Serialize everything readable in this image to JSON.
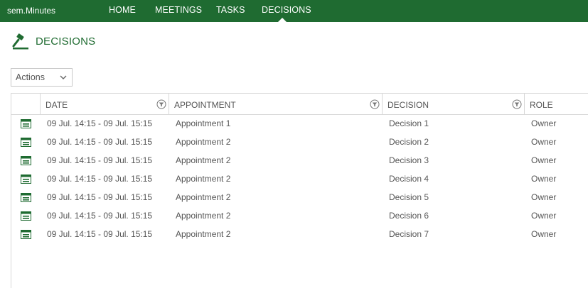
{
  "app": {
    "brand": "sem.Minutes"
  },
  "nav": {
    "items": [
      {
        "label": "HOME"
      },
      {
        "label": "MEETINGS"
      },
      {
        "label": "TASKS"
      },
      {
        "label": "DECISIONS",
        "active": true
      }
    ]
  },
  "page": {
    "title": "DECISIONS",
    "icon": "gavel-icon"
  },
  "toolbar": {
    "actions_label": "Actions"
  },
  "table": {
    "columns": [
      "DATE",
      "APPOINTMENT",
      "DECISION",
      "ROLE"
    ],
    "rows": [
      {
        "date": "09 Jul. 14:15 - 09 Jul. 15:15",
        "appointment": "Appointment 1",
        "decision": "Decision 1",
        "role": "Owner"
      },
      {
        "date": "09 Jul. 14:15 - 09 Jul. 15:15",
        "appointment": "Appointment 2",
        "decision": "Decision 2",
        "role": "Owner"
      },
      {
        "date": "09 Jul. 14:15 - 09 Jul. 15:15",
        "appointment": "Appointment 2",
        "decision": "Decision 3",
        "role": "Owner"
      },
      {
        "date": "09 Jul. 14:15 - 09 Jul. 15:15",
        "appointment": "Appointment 2",
        "decision": "Decision 4",
        "role": "Owner"
      },
      {
        "date": "09 Jul. 14:15 - 09 Jul. 15:15",
        "appointment": "Appointment 2",
        "decision": "Decision 5",
        "role": "Owner"
      },
      {
        "date": "09 Jul. 14:15 - 09 Jul. 15:15",
        "appointment": "Appointment 2",
        "decision": "Decision 6",
        "role": "Owner"
      },
      {
        "date": "09 Jul. 14:15 - 09 Jul. 15:15",
        "appointment": "Appointment 2",
        "decision": "Decision 7",
        "role": "Owner"
      }
    ]
  },
  "colors": {
    "brand_green": "#1f6b31",
    "border": "#d8d8d8",
    "text": "#555555"
  }
}
